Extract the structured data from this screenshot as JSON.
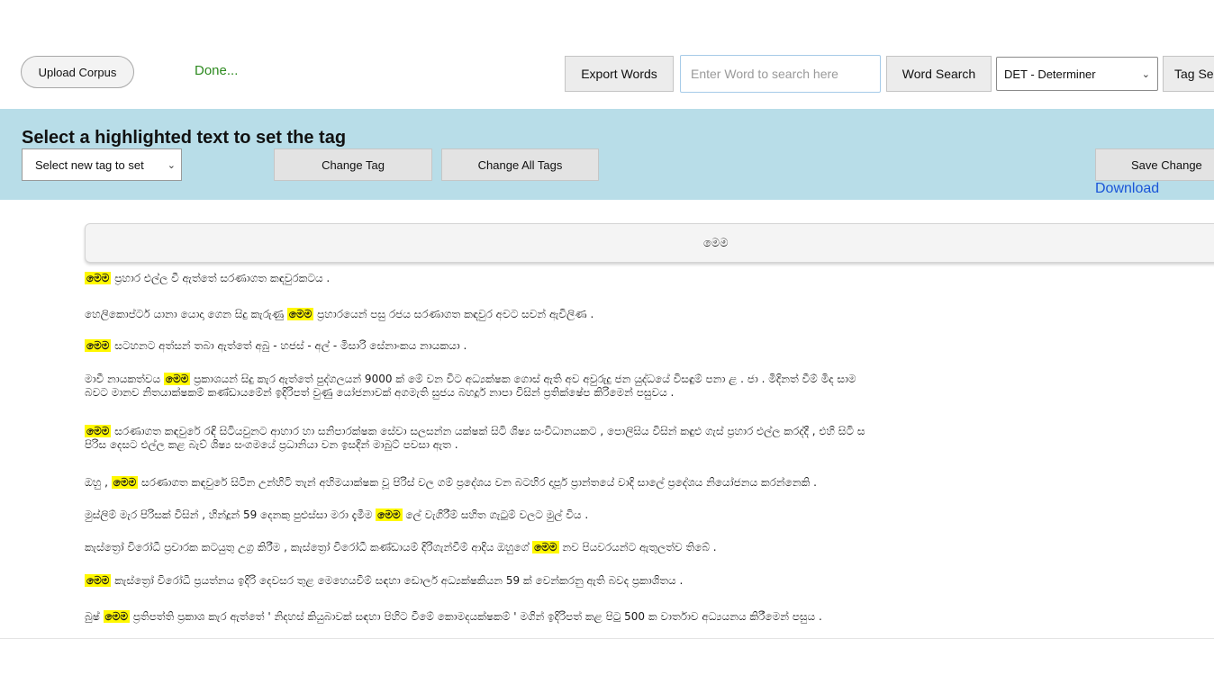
{
  "toolbar": {
    "upload_label": "Upload Corpus",
    "status": "Done...",
    "export_label": "Export Words",
    "search_placeholder": "Enter Word to search here",
    "search_value": "",
    "word_search_label": "Word Search",
    "pos_selected": "DET - Determiner",
    "tag_search_label": "Tag Se"
  },
  "tag_panel": {
    "title": "Select a highlighted text to set the tag",
    "new_tag_placeholder": "Select new tag to set",
    "change_tag_label": "Change Tag",
    "change_all_label": "Change All Tags",
    "save_label": "Save Change",
    "download_label": "Download"
  },
  "colors": {
    "panel_bg": "#b8dde8",
    "highlight": "#fff800",
    "status_green": "#2d8a1f",
    "link_blue": "#1a55d8"
  },
  "selected_word": "මෙම",
  "sentences": [
    {
      "parts": [
        {
          "hl": true,
          "t": "මෙම"
        },
        {
          "hl": false,
          "t": " ප්‍රහාර එල්ල වී ඇත්තේ සරණාගත කඳවුරකටය ."
        }
      ]
    },
    {
      "parts": [
        {
          "hl": false,
          "t": "හෙලිකොප්ටර් යානා යොදා ගෙන සිදු කැරුණු "
        },
        {
          "hl": true,
          "t": "මෙම"
        },
        {
          "hl": false,
          "t": " ප්‍රහාරයෙන් පසු රජය සරණාගත කඳවුර අවට සවන් ඇවිලිණ ."
        }
      ]
    },
    {
      "parts": [
        {
          "hl": true,
          "t": "මෙම"
        },
        {
          "hl": false,
          "t": " සටහනට අත්සන් තබා ඇත්තේ අබු - හජස් - අල් - මිසාරි සේනාංකය නායකයා ."
        }
      ]
    },
    {
      "lines": [
        [
          {
            "hl": false,
            "t": "මාවී නායකත්වය "
          },
          {
            "hl": true,
            "t": "මෙම"
          },
          {
            "hl": false,
            "t": " ප්‍රකාශයන් සිදු කැර ඇත්තේ පුද්ගලයන් 9000 ක් මේ වන විට අධ්‍යක්ෂක ගොස් ඇති අව අවුරුදු ජන යුද්ධයේ විසඳුම් පනා ළ . ජා . මිදිනත් වීම් මිද සාම"
          }
        ],
        [
          {
            "hl": false,
            "t": "බවට මානව නිතයාක්ෂකම් කණ්ඩායමේන් ඉදිරිපත් වුණු යෝජනාවක් අගමැති සුජය බහදූර් නාපා විසින් ප්‍රතික්ෂේප කිරිමෙන් පසුවය ."
          }
        ]
      ]
    },
    {
      "lines": [
        [
          {
            "hl": true,
            "t": "මෙම"
          },
          {
            "hl": false,
            "t": " සරණාගත කඳවුරේ රඳි සිටියවුනට ආහාර හා සනිපාරක්ෂක සේවා සලසන්න යක්ෂක් සිටි ශිෂ්‍ය සංවිධානයකට , පොලිසිය විසින් කඳුළු ගැස් ප්‍රහාර එල්ල කරද්දී , එහි සිටි ස"
          }
        ],
        [
          {
            "hl": false,
            "t": "පිරිස දෙසට එල්ල කළ බැව් ශිෂ්‍ය සංගමයේ ප්‍රධානියා වන ඉසදීන් මාබුට් පවසා ඇත ."
          }
        ]
      ]
    },
    {
      "parts": [
        {
          "hl": false,
          "t": "ඔහු , "
        },
        {
          "hl": true,
          "t": "මෙම"
        },
        {
          "hl": false,
          "t": " සරණාගත කඳවුරේ සිටින උන්හිටි තැන් අහිමයාක්ෂක වූ පිරිස් වල ගම් ප්‍රදේශය වන බටහිර දාපූර් ප්‍රාන්තයේ වාදි සාලේ ප්‍රදේශය නියෝජනය කරන්නෙකි ."
        }
      ]
    },
    {
      "parts": [
        {
          "hl": false,
          "t": "මුස්ලිම් මැර පිරිසක් විසින් , හින්දූන් 59 දෙනකු පුළුස්සා මරා දැමීම "
        },
        {
          "hl": true,
          "t": "මෙම"
        },
        {
          "hl": false,
          "t": " ලේ වැගිරීම් සහිත ගැටුම් වලට මුල් විය ."
        }
      ]
    },
    {
      "parts": [
        {
          "hl": false,
          "t": "කැස්ත්‍රෝ විරෝධී ප්‍රචාරක කටයුතු උග්‍ර කිරීම , කැස්ත්‍රෝ විරෝධී කණ්ඩායම් දිරිගැන්වීම් ආදිය ඔහුගේ "
        },
        {
          "hl": true,
          "t": "මෙම"
        },
        {
          "hl": false,
          "t": " නව පියවරයන්ට ඇතුලත්ව තිබේ ."
        }
      ]
    },
    {
      "parts": [
        {
          "hl": true,
          "t": "මෙම"
        },
        {
          "hl": false,
          "t": " කැස්ත්‍රෝ විරෝධී ප්‍රයත්නය ඉදිරි දෙවසර තුළ මෙහෙයවීම් සඳහා ඩොලර් අධ්‍යක්ෂකියන 59 ක් වෙන්කරනු ඇති බවද ප්‍රකාශිතය ."
        }
      ]
    },
    {
      "parts": [
        {
          "hl": false,
          "t": "බුෂ් "
        },
        {
          "hl": true,
          "t": "මෙම"
        },
        {
          "hl": false,
          "t": " ප්‍රතිපත්ති ප්‍රකාශ කැර ඇත්තේ ' නිදහස් කියුබාවක් සඳහා පිහිට වීමේ කොමදයක්ෂකම් ' මගින් ඉදිරිපත් කළ පිටු 500 ක වාර්තාව අධ්‍යයනය කිරීමෙන් පසුය ."
        }
      ]
    }
  ]
}
